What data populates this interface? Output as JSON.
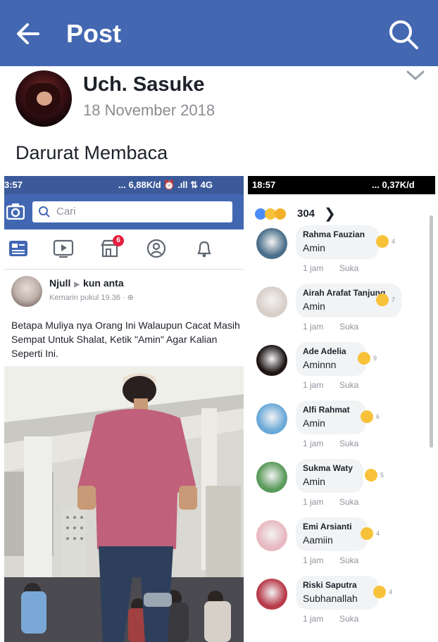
{
  "header": {
    "title": "Post"
  },
  "post": {
    "author": "Uch. Sasuke",
    "date": "18 November 2018",
    "text": "Darurat Membaca"
  },
  "left_screenshot": {
    "status_time": "3:57",
    "status_net": "... 6,88K/d ⏰ .ıll ⇅ 4G",
    "search_placeholder": "Cari",
    "notification_badge": "6",
    "author": "Njull",
    "target": "kun anta",
    "meta": "Kemarin pukul 19.36 · ⊕",
    "text": "Betapa Muliya nya Orang Ini Walaupun Cacat Masih Sempat Untuk Shalat, Ketik \"Amin\" Agar Kalian Seperti Ini."
  },
  "right_screenshot": {
    "status_time": "18:57",
    "status_net": "... 0,37K/d",
    "reaction_count": "304",
    "more": "❯",
    "comments": [
      {
        "name": "Rahma Fauzian",
        "text": "Amin",
        "time": "1 jam",
        "like": "Suka",
        "reacts": "4"
      },
      {
        "name": "Airah Arafat Tanjung",
        "text": "Amin",
        "time": "1 jam",
        "like": "Suka",
        "reacts": "7"
      },
      {
        "name": "Ade Adelia",
        "text": "Aminnn",
        "time": "1 jam",
        "like": "Suka",
        "reacts": "9"
      },
      {
        "name": "Alfi Rahmat",
        "text": "Amin",
        "time": "1 jam",
        "like": "Suka",
        "reacts": "6"
      },
      {
        "name": "Sukma Waty",
        "text": "Amin",
        "time": "1 jam",
        "like": "Suka",
        "reacts": "5"
      },
      {
        "name": "Emi Arsianti",
        "text": "Aamiin",
        "time": "1 jam",
        "like": "Suka",
        "reacts": "4"
      },
      {
        "name": "Riski Saputra",
        "text": "Subhanallah",
        "time": "1 jam",
        "like": "Suka",
        "reacts": "4"
      }
    ]
  },
  "icons": {
    "back": "arrow-left-icon",
    "search": "search-icon",
    "expand": "chevron-down-icon"
  },
  "colors": {
    "brand": "#4367b1",
    "fb_blue": "#4267b2",
    "notification": "#e41e3f",
    "reaction_yellow": "#f7c23a"
  }
}
